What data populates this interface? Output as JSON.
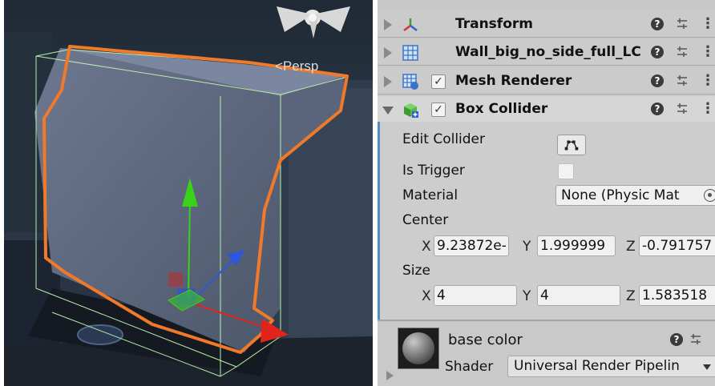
{
  "scene": {
    "persp_label": "<Persp",
    "colors": {
      "background": "#2a3442",
      "outline": "#f07a2a",
      "wireframe": "#b8f0a8",
      "y_axis": "#39d21b",
      "x_axis": "#e2231a",
      "z_axis": "#2d55e0"
    }
  },
  "inspector": {
    "components": [
      {
        "title": "Transform",
        "icon": "transform-icon",
        "expanded": false,
        "has_checkbox": false
      },
      {
        "title": "Wall_big_no_side_full_LC",
        "icon": "grid-mesh-icon",
        "expanded": false,
        "has_checkbox": false
      },
      {
        "title": "Mesh Renderer",
        "icon": "mesh-renderer-icon",
        "expanded": false,
        "has_checkbox": true,
        "checked": true
      },
      {
        "title": "Box Collider",
        "icon": "box-collider-icon",
        "expanded": true,
        "has_checkbox": true,
        "checked": true
      }
    ],
    "checkmark": "✓",
    "help_glyph": "?",
    "more_glyph": "⋮",
    "box_collider": {
      "edit_collider_label": "Edit Collider",
      "is_trigger_label": "Is Trigger",
      "is_trigger": false,
      "material_label": "Material",
      "material_value": "None (Physic Mat",
      "center_label": "Center",
      "center": {
        "x": "9.23872e-",
        "y": "1.999999",
        "z": "-0.791757"
      },
      "size_label": "Size",
      "size": {
        "x": "4",
        "y": "4",
        "z": "1.583518"
      },
      "axis_labels": {
        "x": "X",
        "y": "Y",
        "z": "Z"
      }
    },
    "material": {
      "name": "base color",
      "shader_label": "Shader",
      "shader_value": "Universal Render Pipelin"
    },
    "accent_color": "#4d8fc9"
  }
}
